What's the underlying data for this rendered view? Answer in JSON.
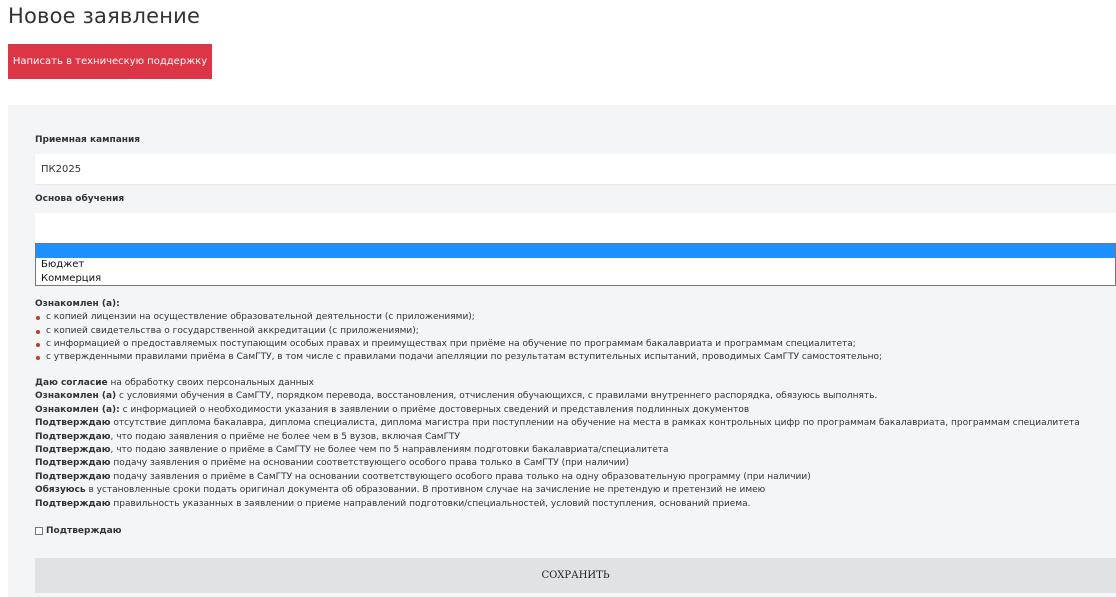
{
  "page": {
    "title": "Новое заявление"
  },
  "support_button": {
    "label": "Написать в техническую поддержку"
  },
  "campaign": {
    "label": "Приемная кампания",
    "value": "ПК2025"
  },
  "basis": {
    "label": "Основа обучения",
    "options": [
      "",
      "Бюджет",
      "Коммерция"
    ]
  },
  "acknowledged": {
    "title": "Ознакомлен (а):",
    "items": [
      "с копией лицензии на осуществление образовательной деятельности (с приложениями);",
      "с копией свидетельства о государственной аккредитации (с приложениями);",
      "с информацией о предоставляемых поступающим особых правах и преимуществах при приёме на обучение по программам бакалавриата и программам специалитета;",
      "с утвержденными правилами приёма в СамГТУ, в том числе с правилами подачи апелляции по результатам вступительных испытаний, проводимых СамГТУ самостоятельно;"
    ]
  },
  "consents": [
    {
      "bold": "Даю согласие",
      "text": " на обработку своих персональных данных"
    },
    {
      "bold": "Ознакомлен (а)",
      "text": " с условиями обучения в СамГТУ, порядком перевода, восстановления, отчисления обучающихся, с правилами внутреннего распорядка, обязуюсь выполнять."
    },
    {
      "bold": "Ознакомлен (а):",
      "text": " с информацией о необходимости указания в заявлении о приёме достоверных сведений и представления подлинных документов"
    },
    {
      "bold": "Подтверждаю",
      "text": " отсутствие диплома бакалавра, диплома специалиста, диплома магистра при поступлении на обучение на места в рамках контрольных цифр по программам бакалавриата, программам специалитета"
    },
    {
      "bold": "Подтверждаю",
      "text": ", что подаю заявления о приёме не более чем в 5 вузов, включая СамГТУ"
    },
    {
      "bold": "Подтверждаю",
      "text": ", что подаю заявление о приёме в СамГТУ не более чем по 5 направлениям подготовки бакалавриата/специалитета"
    },
    {
      "bold": "Подтверждаю",
      "text": " подачу заявления о приёме на основании соответствующего особого права только в СамГТУ (при наличии)"
    },
    {
      "bold": "Подтверждаю",
      "text": " подачу заявления о приёме в СамГТУ на основании соответствующего особого права только на одну образовательную программу (при наличии)"
    },
    {
      "bold": "Обязуюсь",
      "text": " в установленные сроки подать оригинал документа об образовании. В противном случае на зачисление не претендую и претензий не имею"
    },
    {
      "bold": "Подтверждаю",
      "text": " правильность указанных в заявлении о приеме направлений подготовки/специальностей, условий поступления, оснований приема."
    }
  ],
  "confirm": {
    "label": "Подтверждаю",
    "checked": false
  },
  "save_button": {
    "label": "СОХРАНИТЬ"
  },
  "colors": {
    "support_button": "#dc3545",
    "panel": "#f4f5f7",
    "save_button": "#e1e2e4",
    "highlight": "#1e90ff"
  }
}
